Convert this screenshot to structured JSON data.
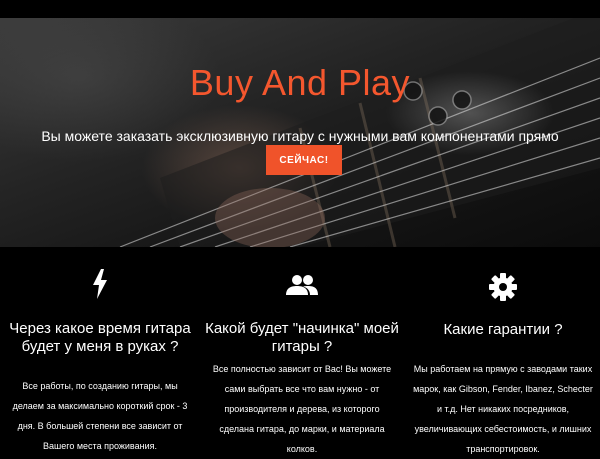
{
  "hero": {
    "title": "Buy And Play",
    "subtitle": "Вы можете заказать эксклюзивную гитару с нужными вам компонентами прямо",
    "button_label": "СЕЙЧАС!"
  },
  "colors": {
    "accent": "#f4572e",
    "button": "#f0532a",
    "background": "#000000",
    "text": "#ffffff"
  },
  "features": [
    {
      "icon": "lightning-bolt-icon",
      "title": "Через какое время гитара будет у меня в руках ?",
      "text": "Все работы, по созданию гитары, мы делаем за максимально короткий срок - 3 дня. В большей степени все зависит от Вашего места проживания."
    },
    {
      "icon": "people-icon",
      "title": "Какой будет \"начинка\" моей гитары ?",
      "text": "Все полностью зависит от Вас! Вы можете сами выбрать все что вам нужно - от производителя и дерева, из которого сделана гитара, до марки, и материала колков."
    },
    {
      "icon": "gear-icon",
      "title": "Какие гарантии ?",
      "text": "Мы работаем на прямую с заводами таких марок, как Gibson, Fender, Ibanez, Schecter и т.д. Нет никаких посредников, увеличивающих себестоимость, и лишних транспортировок."
    }
  ]
}
